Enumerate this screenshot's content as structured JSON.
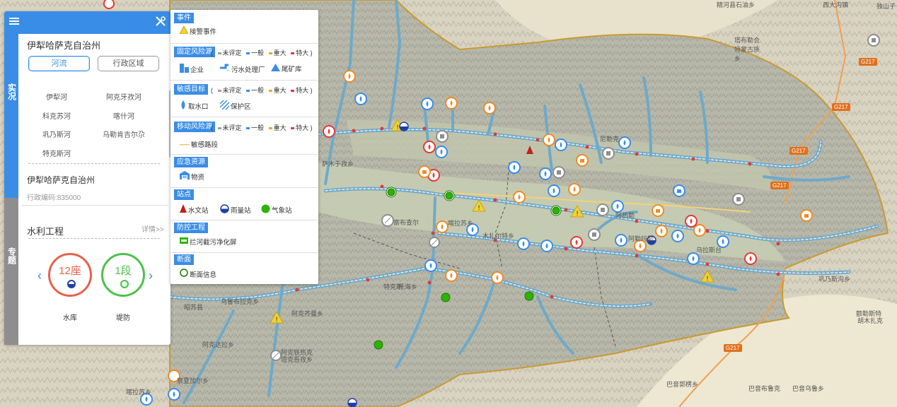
{
  "map": {
    "labels": [
      "精河县石油乡",
      "西大沟镇",
      "独山子",
      "塔布勒合特蒙古族乡",
      "萨木于孜乡",
      "察布查尔",
      "尼勒克",
      "阿勒玛勒",
      "巩乃斯沟乡",
      "额勒斯特",
      "胡木扎克",
      "巴音郭楞乡",
      "巴音布鲁克",
      "巴音乌鲁乡",
      "阿克达拉乡",
      "乌鲁布拉克乡",
      "阿克齐曼乡",
      "阿克铁热克",
      "塔克吾孜乡",
      "特克斯",
      "喀拉苏乡",
      "昭苏县",
      "察夏加尔乡",
      "喀拉苏乡",
      "托海乡",
      "木扎尔特乡",
      "乌拉斯台",
      "阿热勒"
    ],
    "roads": [
      "G217",
      "G217",
      "G217",
      "G217",
      "G217"
    ]
  },
  "side_panel": {
    "menu_icon": "menu-icon",
    "tools_icon": "tools-icon",
    "tab_realtime": "实况",
    "tab_topic": "专题",
    "region_title": "伊犁哈萨克自治州",
    "toggle_river": "河流",
    "toggle_admin": "行政区域",
    "rivers": [
      "伊犁河",
      "阿克牙孜河",
      "科克苏河",
      "喀什河",
      "巩乃斯河",
      "乌勒肯吉尔尕",
      "特克斯河"
    ],
    "region_name": "伊犁哈萨克自治州",
    "region_code": "行政编码:835000",
    "water_title": "水利工程",
    "details_link": "详情>>",
    "reservoir_value": "12座",
    "reservoir_label": "水库",
    "dike_value": "1段",
    "dike_label": "堤防"
  },
  "legend": {
    "events_head": "事件",
    "alarm_event": "接警事件",
    "fixed_head": "固定风险源",
    "levels": [
      "未评定",
      "一般",
      "重大",
      "特大"
    ],
    "paren_open": "(",
    "paren_close": ")",
    "enterprise": "企业",
    "sewage": "污水处理厂",
    "tailings": "尾矿库",
    "sensitive_head": "敏感目标",
    "water_intake": "取水口",
    "protected_area": "保护区",
    "mobile_head": "移动风险源",
    "sensitive_road": "敏感路段",
    "emergency_head": "应急资源",
    "materials": "物资",
    "station_head": "站点",
    "hydro_station": "水文站",
    "rain_station": "雨量站",
    "weather_station": "气象站",
    "control_head": "防控工程",
    "river_screen": "拦河截污净化屏",
    "section_head": "断面",
    "section_info": "断面信息",
    "level_colors": [
      "#9e9e9e",
      "#3a8de6",
      "#f5a623",
      "#e53935"
    ]
  }
}
